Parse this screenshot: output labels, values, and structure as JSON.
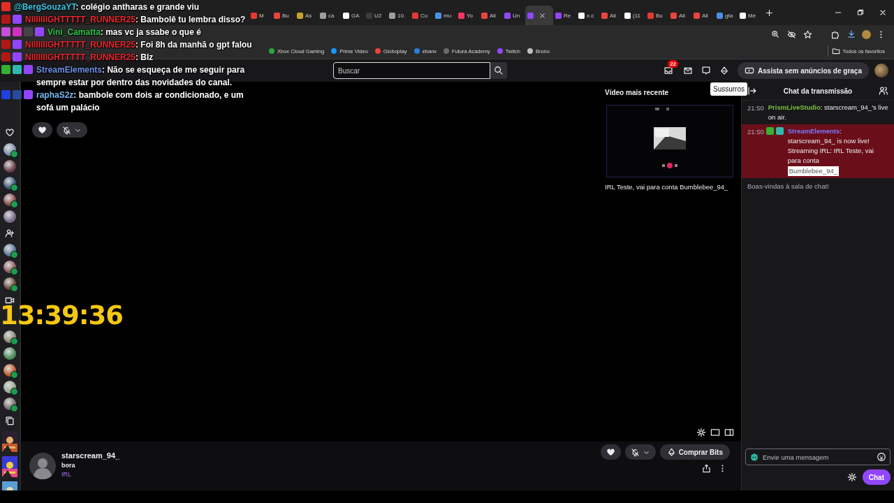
{
  "browser": {
    "tabs": [
      {
        "title": "M",
        "color": "#e53935",
        "selected": false
      },
      {
        "title": "Bu",
        "color": "#e8453c",
        "selected": false
      },
      {
        "title": "As",
        "color": "#c9a227",
        "selected": false
      },
      {
        "title": "ca",
        "color": "#9aa0a6",
        "selected": false
      },
      {
        "title": "GA",
        "color": "#ffffff",
        "selected": false
      },
      {
        "title": "U2",
        "color": "#3c3c3c",
        "selected": false
      },
      {
        "title": "10.",
        "color": "#9aa0a6",
        "selected": false
      },
      {
        "title": "Co",
        "color": "#e53935",
        "selected": false
      },
      {
        "title": "mu",
        "color": "#4a90e2",
        "selected": false
      },
      {
        "title": "Yo",
        "color": "#ff3366",
        "selected": false
      },
      {
        "title": "Ali",
        "color": "#e8453c",
        "selected": false
      },
      {
        "title": "Un",
        "color": "#9146ff",
        "selected": false
      },
      {
        "color": "#9146ff",
        "selected": true
      },
      {
        "title": "Re",
        "color": "#9146ff",
        "selected": false
      },
      {
        "title": "x.c",
        "color": "#ffffff",
        "selected": false
      },
      {
        "title": "Ali",
        "color": "#e8453c",
        "selected": false
      },
      {
        "title": "(11",
        "color": "#ffffff",
        "selected": false
      },
      {
        "title": "Bu",
        "color": "#e53935",
        "selected": false
      },
      {
        "title": "Ali",
        "color": "#e8453c",
        "selected": false
      },
      {
        "title": "Ali",
        "color": "#e8453c",
        "selected": false
      },
      {
        "title": "gta",
        "color": "#4a90e2",
        "selected": false
      },
      {
        "title": "Me",
        "color": "#ffffff",
        "selected": false
      }
    ],
    "bookmarks": [
      {
        "title": "Xbox Cloud Gaming",
        "color": "#2ca243"
      },
      {
        "title": "Prime Video",
        "color": "#1a98ff"
      },
      {
        "title": "Globoplay",
        "color": "#e8453c"
      },
      {
        "title": "ebanx",
        "color": "#2a7de1"
      },
      {
        "title": "Futura Academy",
        "color": "#6b6b6b"
      },
      {
        "title": "Twitch",
        "color": "#9146ff"
      },
      {
        "title": "Bruno",
        "color": "#c0c0c0"
      }
    ],
    "all_bookmarks": "Todos os favoritos"
  },
  "overlay_chat": [
    {
      "badges": [
        {
          "kind": "youtube"
        }
      ],
      "name": "@BergSouzaYT",
      "color": "#3ac8e8",
      "text": ": colégio antharas e grande viu"
    },
    {
      "badges": [
        {
          "kind": "channel"
        },
        {
          "kind": "twitch"
        }
      ],
      "name": "NIIIIIIIGHTTTTT_RUNNER25",
      "color": "#e8262e",
      "text": ": Bambolê tu lembra disso?"
    },
    {
      "badges": [
        {
          "kind": "sub"
        },
        {
          "kind": "gift"
        },
        {
          "kind": "gamepad"
        },
        {
          "kind": "twitch"
        }
      ],
      "name": "Vini_Camatta",
      "color": "#2ec24a",
      "text": ": mas vc ja ssabe o que é"
    },
    {
      "badges": [
        {
          "kind": "channel"
        },
        {
          "kind": "twitch"
        }
      ],
      "name": "NIIIIIIIGHTTTTT_RUNNER25",
      "color": "#e8262e",
      "text": ": Foi 8h da manhã o gpt falou"
    },
    {
      "badges": [
        {
          "kind": "channel"
        },
        {
          "kind": "twitch"
        }
      ],
      "name": "NIIIIIIIGHTTTTT_RUNNER25",
      "color": "#e8262e",
      "text": ": Blz"
    },
    {
      "badges": [
        {
          "kind": "verified"
        },
        {
          "kind": "bot"
        },
        {
          "kind": "twitch"
        }
      ],
      "name": "StreamElements",
      "color": "#6f8fe8",
      "text": ": Não se esqueça de me seguir para sempre estar por dentro das novidades do canal."
    },
    {
      "badges": [
        {
          "kind": "dot"
        },
        {
          "kind": "prime"
        },
        {
          "kind": "twitch"
        }
      ],
      "name": "raphaS2z",
      "color": "#7ab8f5",
      "text": ": bambole com dois ar condicionado, e um sofá um palácio"
    }
  ],
  "top_nav": {
    "search_placeholder": "Buscar",
    "notification_count": "22",
    "ad_free_button": "Assista sem anúncios de graça",
    "tooltip": "Sussurros"
  },
  "sidebar": [
    {
      "kind": "heart"
    },
    {
      "kind": "avatar",
      "live": true
    },
    {
      "kind": "avatar",
      "live": false
    },
    {
      "kind": "avatar",
      "live": true
    },
    {
      "kind": "avatar",
      "live": true
    },
    {
      "kind": "avatar",
      "live": false
    },
    {
      "kind": "follow"
    },
    {
      "kind": "avatar",
      "live": true
    },
    {
      "kind": "avatar",
      "live": true
    },
    {
      "kind": "avatar",
      "live": true
    },
    {
      "kind": "camera"
    },
    {
      "kind": "avatar",
      "live": true
    },
    {
      "kind": "avatar",
      "live": false
    },
    {
      "kind": "avatar",
      "live": true
    },
    {
      "kind": "avatar",
      "live": true
    },
    {
      "kind": "avatar",
      "live": true
    },
    {
      "kind": "stack"
    },
    {
      "kind": "cover"
    },
    {
      "kind": "cover"
    },
    {
      "kind": "cover"
    }
  ],
  "clock": "13:39:36",
  "recent_video": {
    "heading": "Vídeo mais recente",
    "title": "IRL Teste, vai para conta Bumblebee_94_"
  },
  "channel": {
    "name": "starscream_94_",
    "stream_title": "bora",
    "category": "IRL",
    "buy_bits": "Comprar Bits"
  },
  "chat": {
    "title": "Chat da transmissão",
    "messages": [
      {
        "time": "21:50",
        "user": "PrismLiveStudio",
        "color": "#7ac143",
        "text": ": starscream_94_'s live on air.",
        "highlighted": false
      },
      {
        "time": "21:50",
        "badges": [
          {
            "kind": "verified"
          },
          {
            "kind": "bot"
          }
        ],
        "user": "StreamElements",
        "color": "#7a7aff",
        "text": ": starscream_94_ is now live! Streaming IRL: IRL Teste, vai para conta",
        "mention": "Bumblebee_94_",
        "highlighted": true
      }
    ],
    "notice": "Boas-vindas à sala de chat!",
    "input_placeholder": "Envie uma mensagem",
    "send_button": "Chat"
  }
}
